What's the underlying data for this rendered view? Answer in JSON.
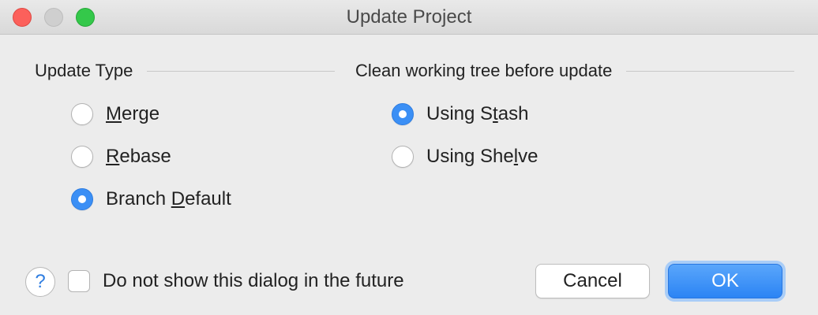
{
  "window": {
    "title": "Update Project"
  },
  "update_type": {
    "header": "Update Type",
    "options": [
      {
        "pre": "",
        "mnemonic": "M",
        "post": "erge",
        "checked": false
      },
      {
        "pre": "",
        "mnemonic": "R",
        "post": "ebase",
        "checked": false
      },
      {
        "pre": "Branch ",
        "mnemonic": "D",
        "post": "efault",
        "checked": true
      }
    ]
  },
  "clean_tree": {
    "header": "Clean working tree before update",
    "options": [
      {
        "pre": "Using S",
        "mnemonic": "t",
        "post": "ash",
        "checked": true
      },
      {
        "pre": "Using She",
        "mnemonic": "l",
        "post": "ve",
        "checked": false
      }
    ]
  },
  "footer": {
    "help_glyph": "?",
    "checkbox_label": "Do not show this dialog in the future",
    "checkbox_checked": false,
    "cancel_label": "Cancel",
    "ok_label": "OK"
  },
  "colors": {
    "accent": "#3b8ff5",
    "close": "#fc605b",
    "maximize": "#34c84a",
    "minimize": "#cfcfcf"
  }
}
